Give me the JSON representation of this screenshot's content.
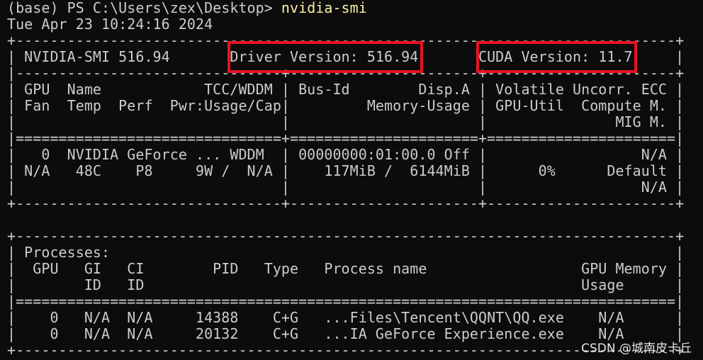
{
  "terminal": {
    "background": "#0c0c0c",
    "foreground": "#cccccc",
    "command_color": "#f9f1a5",
    "highlight_color": "#e81123",
    "prompt": "(base) PS C:\\Users\\zex\\Desktop> ",
    "command": "nvidia-smi",
    "lines": [
      "Tue Apr 23 10:24:16 2024",
      "+-----------------------------------------------------------------------------+",
      "| NVIDIA-SMI 516.94       Driver Version: 516.94       CUDA Version: 11.7     |",
      "|-------------------------------+----------------------+----------------------+",
      "| GPU  Name            TCC/WDDM | Bus-Id        Disp.A | Volatile Uncorr. ECC |",
      "| Fan  Temp  Perf  Pwr:Usage/Cap|         Memory-Usage | GPU-Util  Compute M. |",
      "|                               |                      |               MIG M. |",
      "|===============================+======================+======================|",
      "|   0  NVIDIA GeForce ... WDDM  | 00000000:01:00.0 Off |                  N/A |",
      "| N/A   48C    P8     9W /  N/A |    117MiB /  6144MiB |      0%      Default |",
      "|                               |                      |                  N/A |",
      "+-------------------------------+----------------------+----------------------+",
      "",
      "+-----------------------------------------------------------------------------+",
      "| Processes:                                                                  |",
      "|  GPU   GI   CI        PID   Type   Process name                  GPU Memory |",
      "|        ID   ID                                                   Usage      |",
      "|=============================================================================|",
      "|    0   N/A  N/A     14388    C+G   ...Files\\Tencent\\QQNT\\QQ.exe    N/A      |",
      "|    0   N/A  N/A     20132    C+G   ...IA GeForce Experience.exe    N/A      |",
      "+-----------------------------------------------------------------------------+"
    ]
  },
  "highlights": {
    "driver_version": "Driver Version: 516.94",
    "cuda_version": "CUDA Version: 11.7"
  },
  "watermark": "CSDN @城南皮卡丘"
}
